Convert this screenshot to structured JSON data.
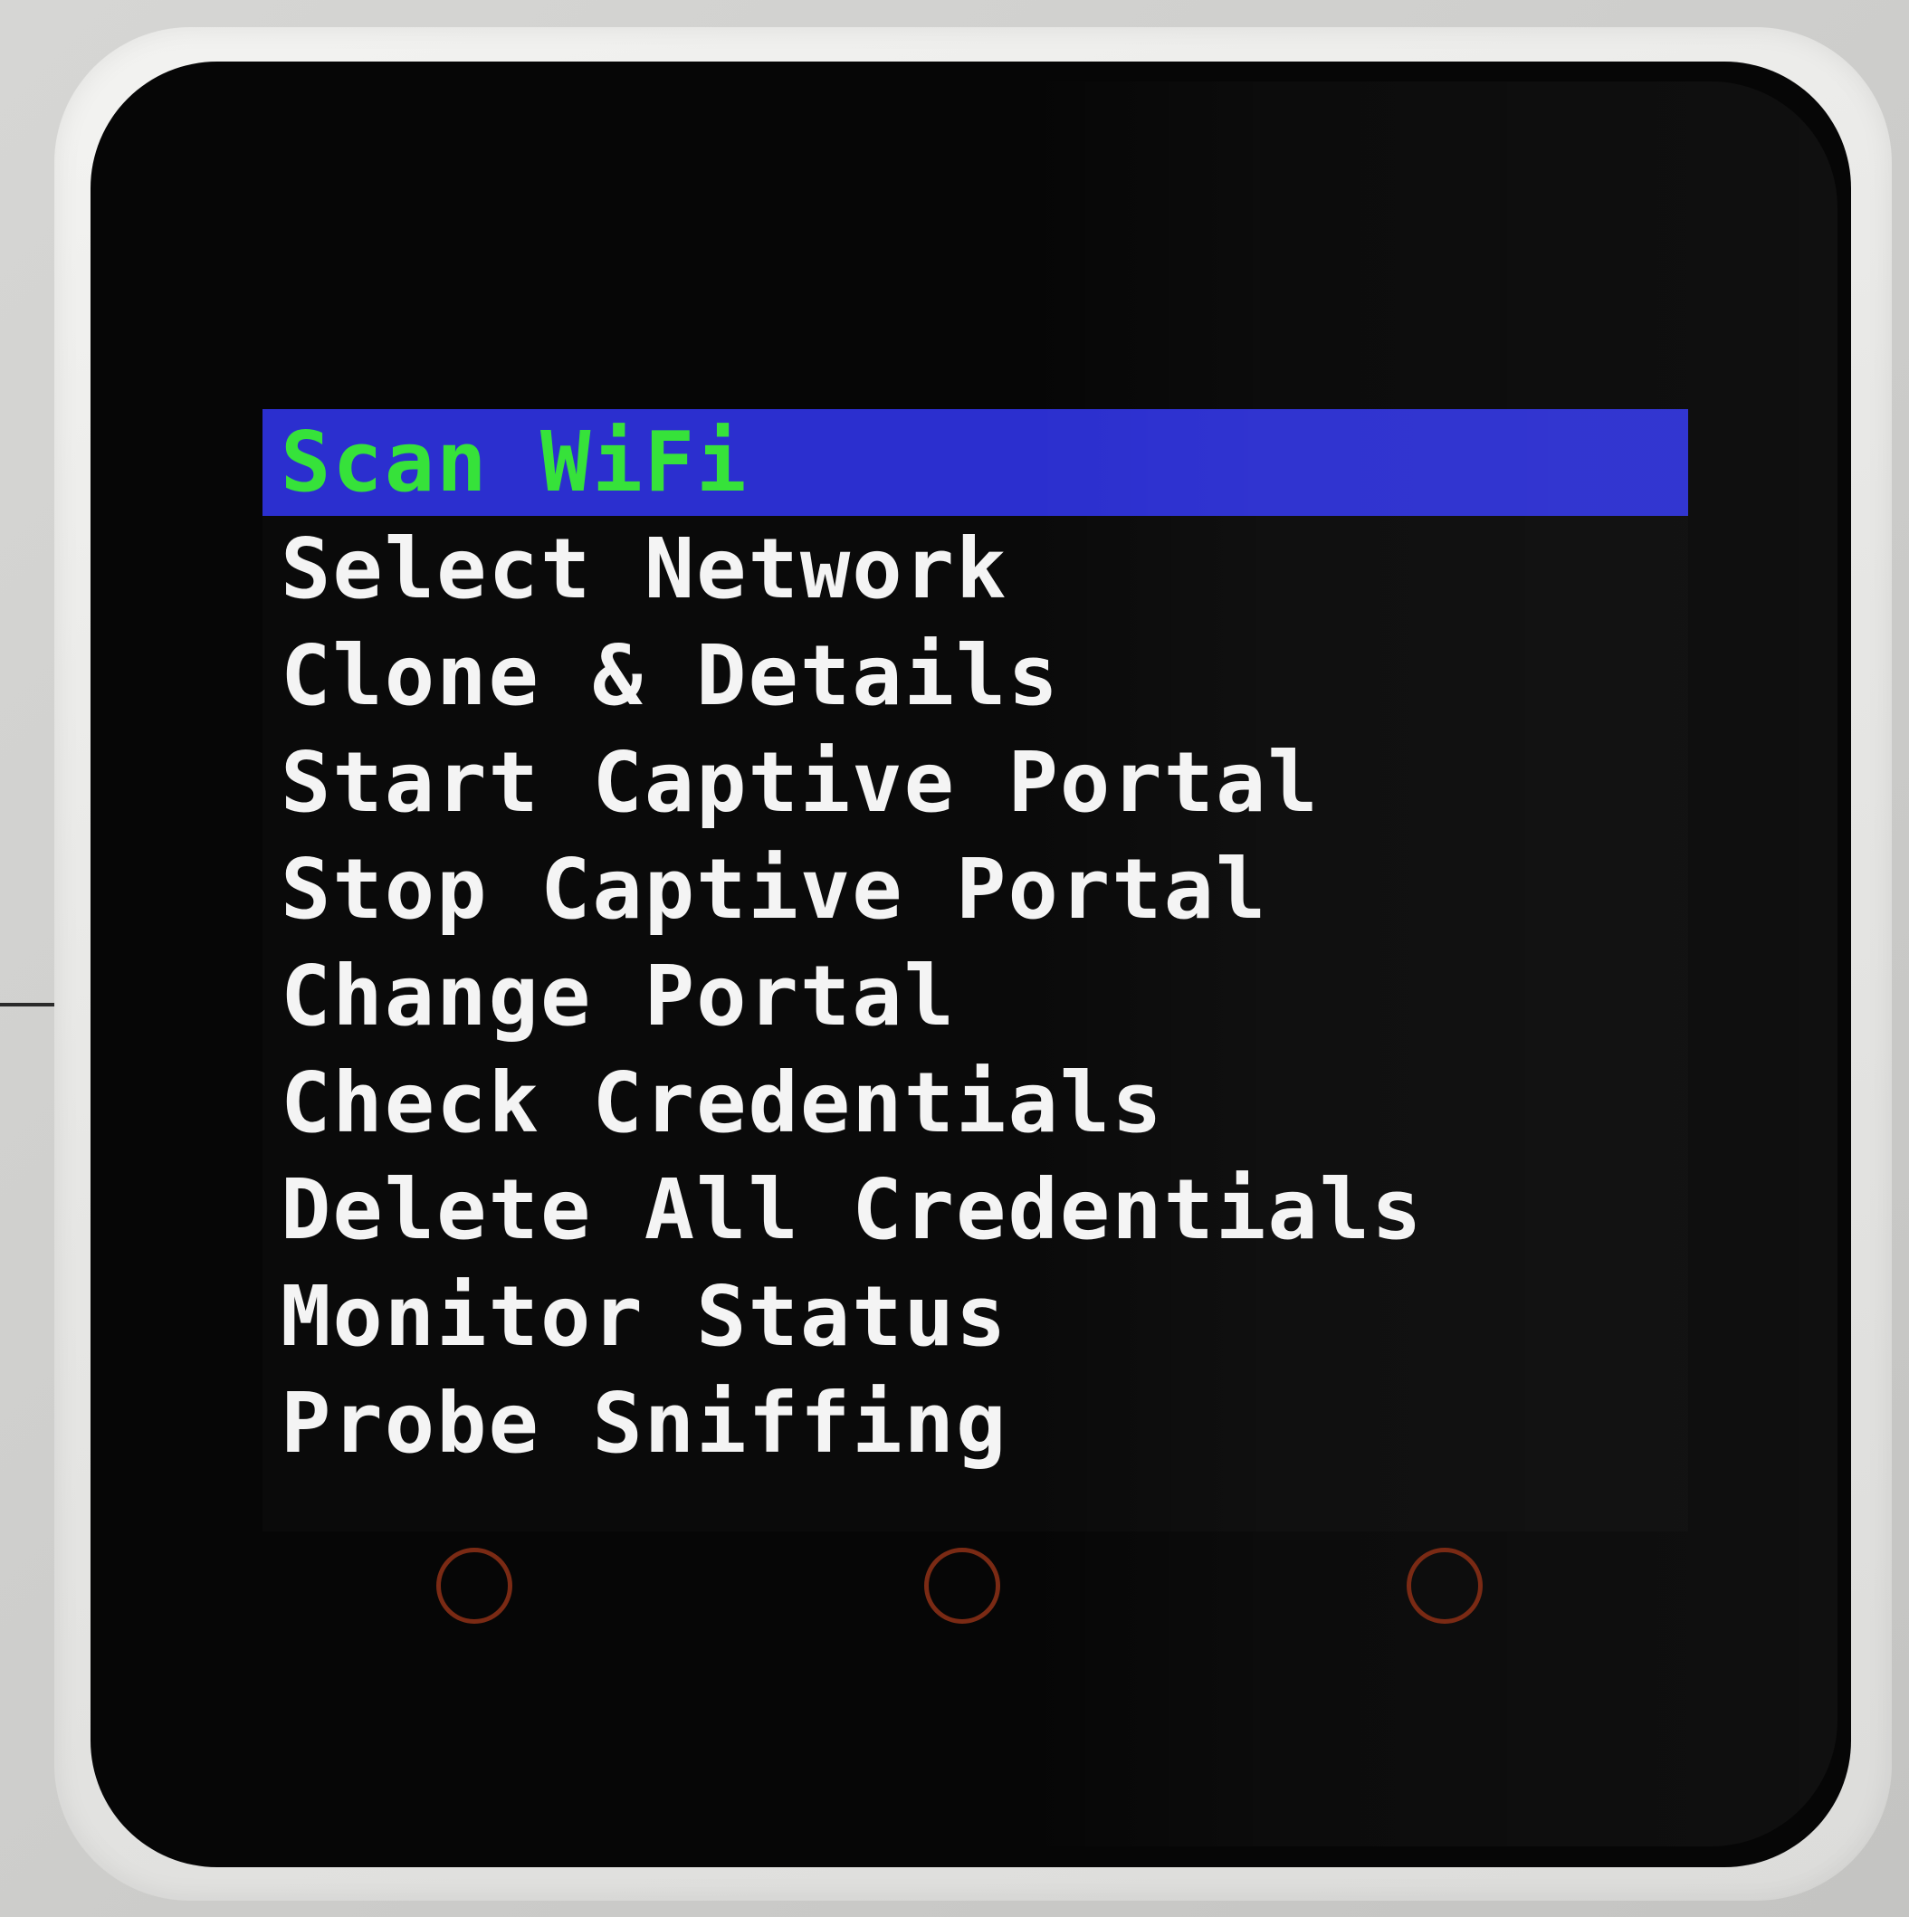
{
  "menu": {
    "items": [
      {
        "label": "Scan WiFi",
        "selected": true
      },
      {
        "label": "Select Network",
        "selected": false
      },
      {
        "label": "Clone & Details",
        "selected": false
      },
      {
        "label": "Start Captive Portal",
        "selected": false
      },
      {
        "label": "Stop Captive Portal",
        "selected": false
      },
      {
        "label": "Change Portal",
        "selected": false
      },
      {
        "label": "Check Credentials",
        "selected": false
      },
      {
        "label": "Delete All Credentials",
        "selected": false
      },
      {
        "label": "Monitor Status",
        "selected": false
      },
      {
        "label": "Probe Sniffing",
        "selected": false
      }
    ]
  },
  "colors": {
    "selected_background": "#2b2fcf",
    "selected_text": "#36e23a",
    "text": "#f4f4f4",
    "screen": "#0a0a0a",
    "button_ring": "#7a2a14"
  },
  "buttons": {
    "left": "hardware-button-left",
    "center": "hardware-button-center",
    "right": "hardware-button-right"
  }
}
